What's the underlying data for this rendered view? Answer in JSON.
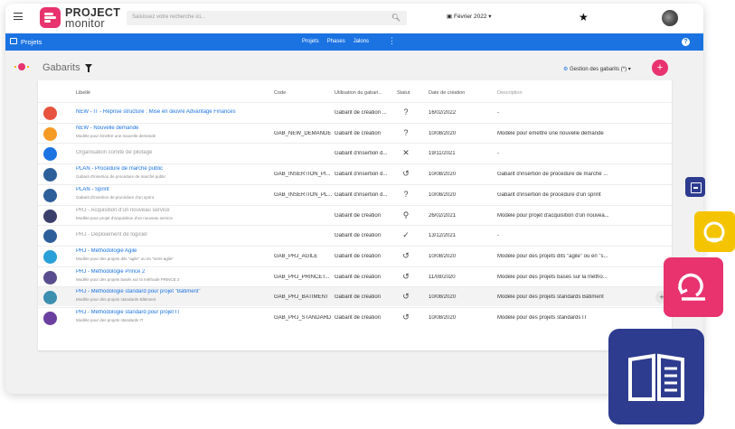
{
  "header": {
    "logo_line1": "PROJECT",
    "logo_line2": "monitor",
    "search_placeholder": "Saisissez votre recherche ici...",
    "date": "Février 2022"
  },
  "navbar": {
    "title": "Projets",
    "links": [
      "Projets",
      "Phases",
      "Jalons"
    ]
  },
  "page": {
    "title": "Gabarits",
    "management_label": "Gestion des gabarits (*)"
  },
  "table": {
    "headers": [
      "Libellé",
      "Code",
      "Utilisation du gabari...",
      "Statut",
      "Date de création",
      "Description"
    ],
    "rows": [
      {
        "title": "NEW - IT - Reprise structure : Mise en œuvre Advantage Finances",
        "subtitle": "",
        "code": "",
        "usage": "Gabarit de création ...",
        "status": "?",
        "date": "16/02/2022",
        "desc": "-",
        "icon_color": "#e8533f",
        "grey": false
      },
      {
        "title": "NEW - Nouvelle demande",
        "subtitle": "Modèle pour émettre une nouvelle demande",
        "code": "GAB_NEW_DEMANDE",
        "usage": "Gabarit de création",
        "status": "?",
        "date": "10/08/2020",
        "desc": "Modèle pour émettre une nouvelle demande",
        "icon_color": "#f59a23",
        "grey": false
      },
      {
        "title": "Organisation comité de pilotage",
        "subtitle": "",
        "code": "",
        "usage": "Gabarit d'insertion d...",
        "status": "✕",
        "date": "19/11/2021",
        "desc": "-",
        "icon_color": "#1b73e2",
        "grey": true
      },
      {
        "title": "PLAN - Procédure de marché public",
        "subtitle": "Gabarit d'insertion de procédure de marché public",
        "code": "GAB_INSERTION_PI...",
        "usage": "Gabarit d'insertion d...",
        "status": "↺",
        "date": "10/08/2020",
        "desc": "Gabarit d'insertion de procédure de marché ...",
        "icon_color": "#2d5f9a",
        "grey": false
      },
      {
        "title": "PLAN - Sprint",
        "subtitle": "Gabarit d'insertion de procédure d'un sprint",
        "code": "GAB_INSERTION_PL...",
        "usage": "Gabarit d'insertion d...",
        "status": "?",
        "date": "10/08/2020",
        "desc": "Gabarit d'insertion de procédure d'un sprint",
        "icon_color": "#2d5f9a",
        "grey": false
      },
      {
        "title": "PRJ - Acquisition d'un nouveau service",
        "subtitle": "Modèle pour projet d'acquisition d'un nouveau service",
        "code": "",
        "usage": "Gabarit de création",
        "status": "⚲",
        "date": "26/02/2021",
        "desc": "Modèle pour projet d'acquisition d'un nouvea...",
        "icon_color": "#3a3f6b",
        "grey": true
      },
      {
        "title": "PRJ - Déploiement de logiciel",
        "subtitle": "",
        "code": "",
        "usage": "Gabarit de création",
        "status": "✓",
        "date": "13/12/2021",
        "desc": "-",
        "icon_color": "#2d5f9a",
        "grey": true
      },
      {
        "title": "PRJ - Méthodologie Agile",
        "subtitle": "Modèle pour des projets dits \"agile\" ou en \"semi-agile\"",
        "code": "GAB_PRJ_AGILE",
        "usage": "Gabarit de création",
        "status": "↺",
        "date": "10/08/2020",
        "desc": "Modèle pour des projets dits \"agile\" ou en \"s...",
        "icon_color": "#2a9fd8",
        "grey": false
      },
      {
        "title": "PRJ - Méthodologie Prince 2",
        "subtitle": "Modèle pour des projets basés sur la méthode PRINCE 2",
        "code": "GAB_PRJ_PRINCET...",
        "usage": "Gabarit de création",
        "status": "↺",
        "date": "11/08/2020",
        "desc": "Modèle pour des projets basés sur la métho...",
        "icon_color": "#5a4d8f",
        "grey": false
      },
      {
        "title": "PRJ - Méthodologie standard pour projet \"Bâtiment\"",
        "subtitle": "Modèle pour des projets standards Bâtiment",
        "code": "GAB_PRJ_BATIMENT",
        "usage": "Gabarit de création",
        "status": "↺",
        "date": "10/08/2020",
        "desc": "Modèle pour des projets standards Bâtiment",
        "icon_color": "#3d8fb0",
        "grey": false
      },
      {
        "title": "PRJ - Méthodologie standard pour projet IT",
        "subtitle": "Modèle pour des projets standards IT",
        "code": "GAB_PRJ_STANDARD",
        "usage": "Gabarit de création",
        "status": "↺",
        "date": "10/08/2020",
        "desc": "Modèle pour des projets standards IT",
        "icon_color": "#6a3fa0",
        "grey": false
      }
    ]
  },
  "colors": {
    "brand_pink": "#e8336f",
    "nav_blue": "#1b73e2",
    "dark_blue": "#2d3c8f",
    "yellow": "#f5c400"
  }
}
